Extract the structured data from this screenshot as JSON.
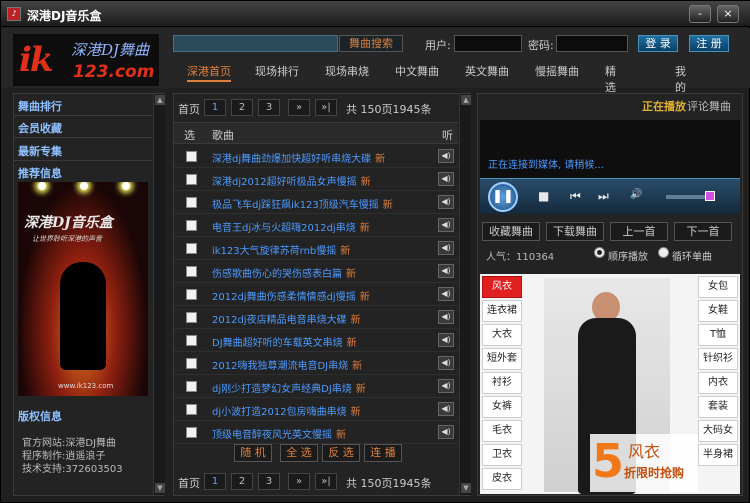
{
  "window": {
    "title": "深港DJ音乐盒",
    "minimize": "-",
    "close": "×"
  },
  "header": {
    "logo_main": "ik",
    "logo_cn": "深港DJ舞曲",
    "logo_domain": "123.com",
    "search_button": "舞曲搜索",
    "user_label": "用户:",
    "password_label": "密码:",
    "login_button": "登 录",
    "register_button": "注 册"
  },
  "nav": [
    "深港首页",
    "现场排行",
    "现场串烧",
    "中文舞曲",
    "英文舞曲",
    "慢摇舞曲",
    "精选舞曲",
    "我的收藏"
  ],
  "sidebar": {
    "items": [
      "舞曲排行",
      "会员收藏",
      "最新专集",
      "推荐信息"
    ],
    "poster_title": "深港DJ音乐盒",
    "poster_sub": "让世界聆听深港的声音",
    "poster_url": "www.ik123.com",
    "copyright_title": "版权信息",
    "copyright_lines": [
      "官方网站:深港DJ舞曲",
      "程序制作:逍遥浪子",
      "技术支持:372603503"
    ]
  },
  "pager": {
    "first": "首页",
    "pages": [
      "1",
      "2",
      "3"
    ],
    "next": "»",
    "last": "»|",
    "summary": "共 150页1945条"
  },
  "table": {
    "col_select": "选",
    "col_song": "歌曲",
    "col_listen": "听",
    "new_badge": "新",
    "rows": [
      "深港dj舞曲劲爆加快超好听串烧大碟",
      "深港dj2012超好听极品女声慢摇",
      "极品飞车dj踩狂飙ik123顶级汽车慢摇",
      "电音王dj冰与火超嗨2012dj串烧",
      "ik123大气旋律苏荷rnb慢摇",
      "伤感歌曲伤心的哭伤感表白篇",
      "2012dj舞曲伤感柔情情感dj慢摇",
      "2012dj夜店精品电音串烧大碟",
      "DJ舞曲超好听的车载英文串烧",
      "2012嗨我独尊潮流电音DJ串烧",
      "dj刚少打造梦幻女声经典DJ串烧",
      "dj小波打造2012包房嗨曲串烧",
      "顶级电音醉夜风光英文慢摇"
    ]
  },
  "actions": [
    "随 机",
    "全 选",
    "反 选",
    "连 播"
  ],
  "player": {
    "now_playing": "正在播放",
    "comment": "评论舞曲",
    "status": "正在连接到媒体, 请稍候...",
    "buttons": [
      "收藏舞曲",
      "下载舞曲",
      "上一首",
      "下一首"
    ],
    "popularity": "人气：110364",
    "mode_order": "顺序播放",
    "mode_repeat": "循环单曲",
    "volume": 0.9
  },
  "ad": {
    "left_cats": [
      "风衣",
      "连衣裙",
      "大衣",
      "短外套",
      "衬衫",
      "女裤",
      "毛衣",
      "卫衣",
      "皮衣"
    ],
    "right_cats": [
      "女包",
      "女鞋",
      "T恤",
      "针织衫",
      "内衣",
      "套装",
      "大码女装",
      "半身裙"
    ],
    "promo_num": "5",
    "promo_text": "风衣",
    "promo_sub": "折限时抢购"
  }
}
